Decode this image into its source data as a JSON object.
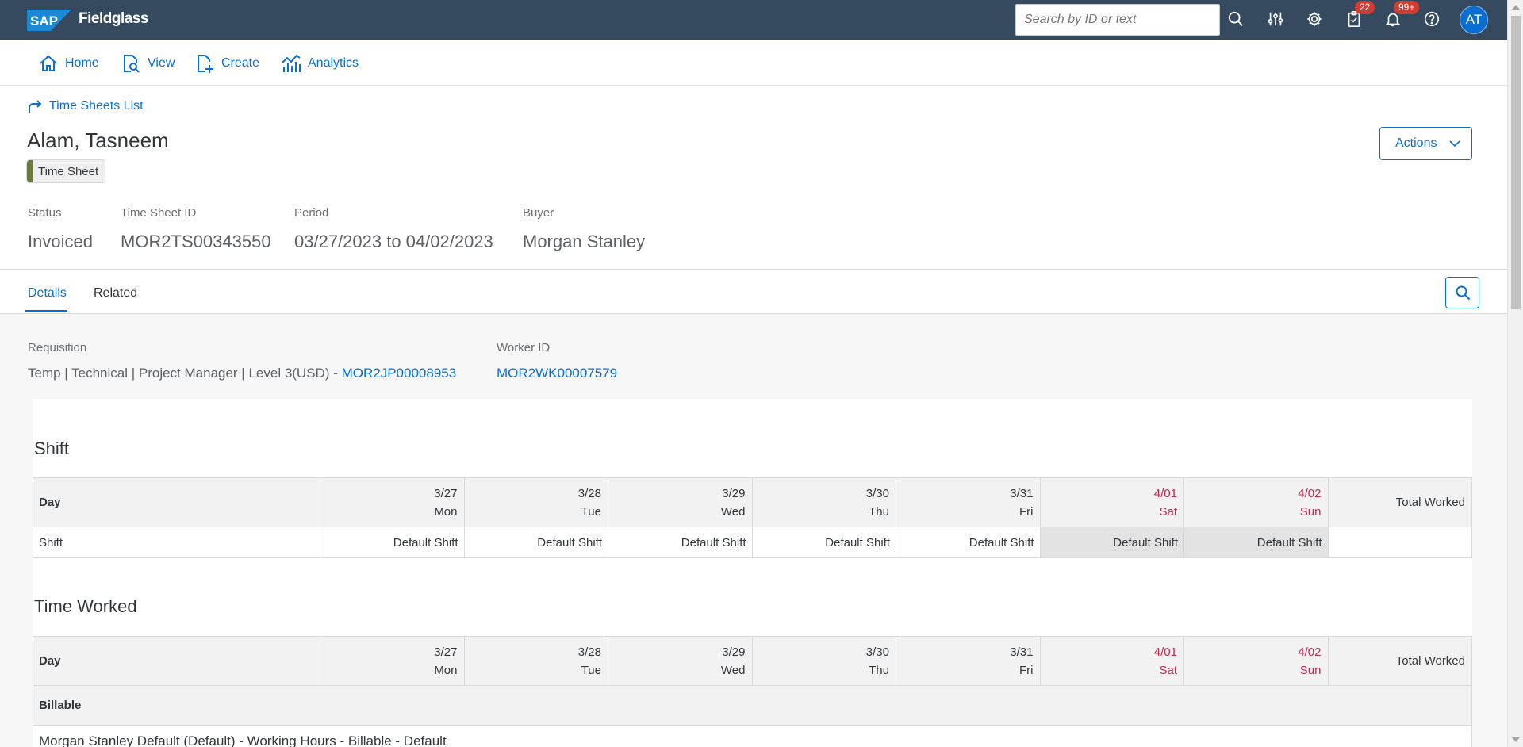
{
  "topbar": {
    "brand": "Fieldglass",
    "logo_text": "SAP",
    "search_placeholder": "Search by ID or text",
    "tasks_badge": "22",
    "notifications_badge": "99+",
    "avatar_initials": "AT",
    "bg_color": "#354a5f"
  },
  "nav": {
    "items": [
      {
        "label": "Home",
        "icon": "home-icon"
      },
      {
        "label": "View",
        "icon": "view-icon"
      },
      {
        "label": "Create",
        "icon": "create-icon"
      },
      {
        "label": "Analytics",
        "icon": "analytics-icon"
      }
    ]
  },
  "header": {
    "breadcrumb": "Time Sheets List",
    "title": "Alam, Tasneem",
    "tag": "Time Sheet",
    "actions_label": "Actions",
    "fields": [
      {
        "label": "Status",
        "value": "Invoiced"
      },
      {
        "label": "Time Sheet ID",
        "value": "MOR2TS00343550"
      },
      {
        "label": "Period",
        "value": "03/27/2023 to 04/02/2023"
      },
      {
        "label": "Buyer",
        "value": "Morgan Stanley"
      }
    ]
  },
  "tabs": [
    {
      "label": "Details",
      "active": true
    },
    {
      "label": "Related",
      "active": false
    }
  ],
  "details": {
    "requisition_label": "Requisition",
    "requisition_text": "Temp | Technical | Project Manager | Level 3(USD) - ",
    "requisition_link": "MOR2JP00008953",
    "worker_label": "Worker ID",
    "worker_link": "MOR2WK00007579"
  },
  "days": [
    {
      "date": "3/27",
      "dow": "Mon",
      "weekend": false
    },
    {
      "date": "3/28",
      "dow": "Tue",
      "weekend": false
    },
    {
      "date": "3/29",
      "dow": "Wed",
      "weekend": false
    },
    {
      "date": "3/30",
      "dow": "Thu",
      "weekend": false
    },
    {
      "date": "3/31",
      "dow": "Fri",
      "weekend": false
    },
    {
      "date": "4/01",
      "dow": "Sat",
      "weekend": true
    },
    {
      "date": "4/02",
      "dow": "Sun",
      "weekend": true
    }
  ],
  "shift": {
    "title": "Shift",
    "day_header": "Day",
    "total_header": "Total Worked",
    "row_label": "Shift",
    "cells": [
      "Default Shift",
      "Default Shift",
      "Default Shift",
      "Default Shift",
      "Default Shift",
      "Default Shift",
      "Default Shift"
    ],
    "total": ""
  },
  "time_worked": {
    "title": "Time Worked",
    "day_header": "Day",
    "total_header": "Total Worked",
    "group_label": "Billable",
    "item_label": "Morgan Stanley Default (Default) - Working Hours - Billable - Default"
  },
  "colors": {
    "accent": "#0a6ed1",
    "weekend": "#c0284f",
    "badge": "#d43c32",
    "tag_stripe": "#6a7b3e"
  }
}
